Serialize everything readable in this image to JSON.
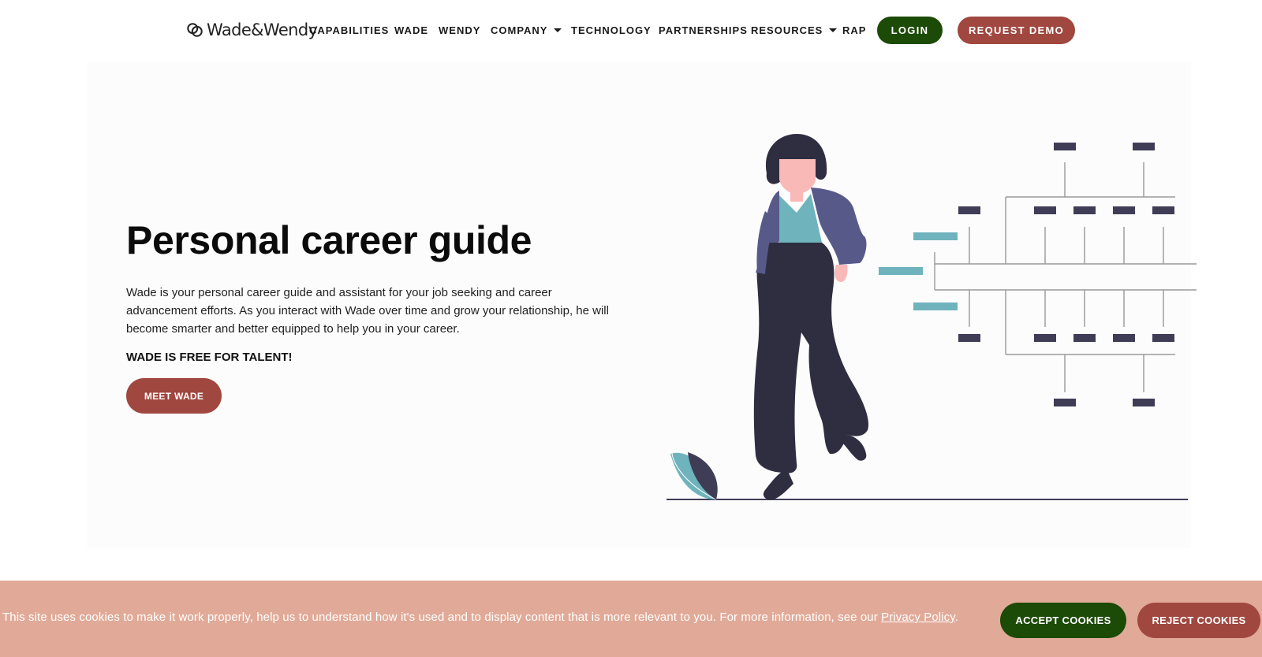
{
  "brand": {
    "logo_text": "Wade&Wendy",
    "logo_icon": "wade-wendy-logo-icon"
  },
  "nav": {
    "links": [
      "CAPABILITIES",
      "WADE",
      "WENDY",
      "COMPANY",
      "TECHNOLOGY",
      "PARTNERSHIPS",
      "RESOURCES",
      "RAP"
    ],
    "login": "LOGIN",
    "request_demo": "REQUEST DEMO"
  },
  "hero": {
    "title": "Personal career guide",
    "body": "Wade is your personal career guide and assistant for your job seeking and career advancement efforts. As you interact with Wade over time and grow your relationship, he will become smarter and better equipped to help you in your career.",
    "free_text": "WADE IS FREE FOR TALENT!",
    "cta": "MEET WADE"
  },
  "cookie": {
    "text": "This site uses cookies to make it work properly, help us to understand how it's used and to display content that is more relevant to you. For more information, see our",
    "link": "Privacy Policy",
    "period": ".",
    "accept": "ACCEPT COOKIES",
    "reject": "REJECT COOKIES"
  },
  "colors": {
    "green": "#1c4a07",
    "brick": "#a04740",
    "cookie_bg": "#e1aa98",
    "navy": "#3f3d56",
    "teal": "#6fb3bc",
    "jacket": "#575a89"
  }
}
